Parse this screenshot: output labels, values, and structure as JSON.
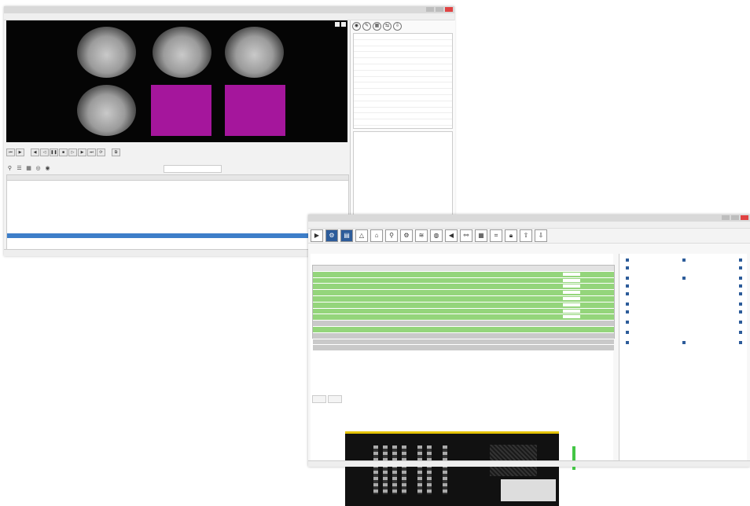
{
  "window1": {
    "menu": [
      "",
      "",
      "",
      "",
      "",
      ""
    ],
    "camera_labels": [
      "",
      "",
      "",
      "",
      "",
      ""
    ],
    "status": ""
  },
  "window2": {
    "menu": [
      "",
      "",
      "",
      "",
      "",
      ""
    ],
    "tabs": [
      "",
      ""
    ],
    "status": ""
  },
  "colors": {
    "accent_green": "#99cc33",
    "row_green": "#94d57b",
    "no_signal": "#a5169c",
    "selection_blue": "#3d7ec9",
    "icon_blue": "#2d5c9a",
    "device_frame_yellow": "#e3c200"
  },
  "icons": {
    "player_controls": [
      "skip-back-icon",
      "play-icon",
      "pause-icon",
      "stop-icon",
      "skip-forward-icon"
    ],
    "toolbar2": [
      "camera-icon",
      "network-icon",
      "settings-icon",
      "lock-icon",
      "export-icon",
      "import-icon"
    ]
  }
}
